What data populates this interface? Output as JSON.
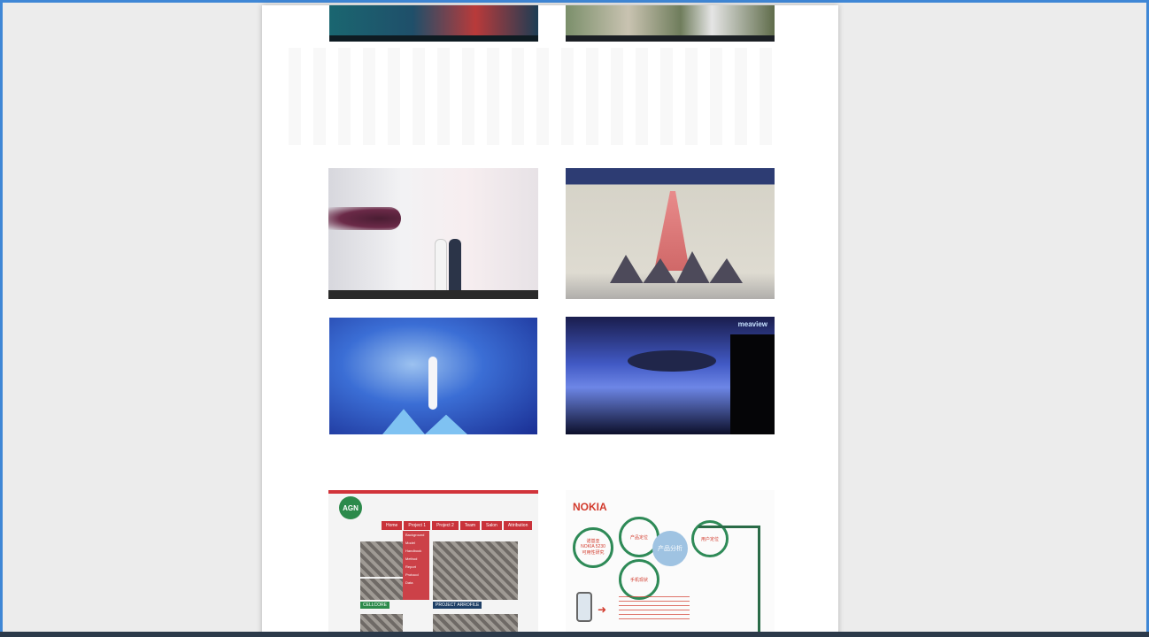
{
  "viewer": {
    "accent_color": "#3f87d6",
    "page_background": "#ffffff"
  },
  "thumbnails": {
    "agn": {
      "logo": "AGN",
      "nav": [
        "Home",
        "Project 1",
        "Project 2",
        "Team",
        "Salon",
        "Attribution"
      ],
      "menu": [
        "Background",
        "Model",
        "Handbook",
        "Method",
        "Report",
        "Protocol",
        "Data"
      ],
      "left_label": "CELLCORE",
      "right_label": "PROJECT ARROFILE"
    },
    "nokia": {
      "title": "NOKIA",
      "left_circle_text": "诺基亚\nNOKIA  5230\n可用性研究",
      "center_circle_text": "产品分析",
      "top_label": "产品定位",
      "bottom_label": "手机现状",
      "right_label": "用户定位"
    },
    "dance4_logo": "meaview"
  }
}
